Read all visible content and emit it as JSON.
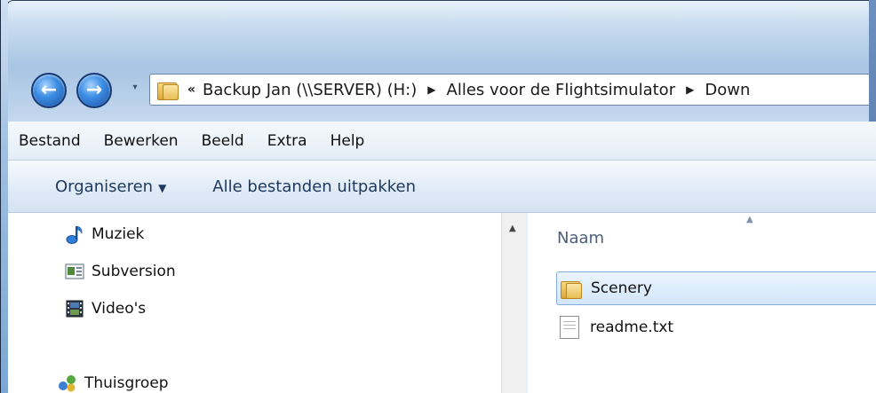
{
  "navigation": {
    "back_glyph": "←",
    "forward_glyph": "→",
    "history_glyph": "▾"
  },
  "address": {
    "overflow_glyph": "«",
    "crumbs": [
      "Backup Jan (\\\\SERVER) (H:)",
      "Alles voor de Flightsimulator",
      "Down"
    ],
    "separator_glyph": "▶"
  },
  "menu": [
    "Bestand",
    "Bewerken",
    "Beeld",
    "Extra",
    "Help"
  ],
  "commands": {
    "organize_label": "Organiseren",
    "organize_caret": "▼",
    "extract_label": "Alle bestanden uitpakken"
  },
  "navpane": {
    "items": [
      {
        "label": "Muziek",
        "icon": "music-note-icon"
      },
      {
        "label": "Subversion",
        "icon": "subversion-icon"
      },
      {
        "label": "Video's",
        "icon": "video-film-icon"
      },
      {
        "label": "Thuisgroep",
        "icon": "homegroup-icon"
      }
    ],
    "scroll_up_glyph": "▲"
  },
  "content": {
    "column_header": "Naam",
    "sort_glyph": "▲",
    "files": [
      {
        "name": "Scenery",
        "type": "folder",
        "selected": true
      },
      {
        "name": "readme.txt",
        "type": "text-file",
        "selected": false
      }
    ]
  },
  "colors": {
    "selection": "#d2e6fa",
    "selection_border": "#84acdd",
    "nav_button": "#3d8fe5",
    "command_text": "#1e395b"
  }
}
